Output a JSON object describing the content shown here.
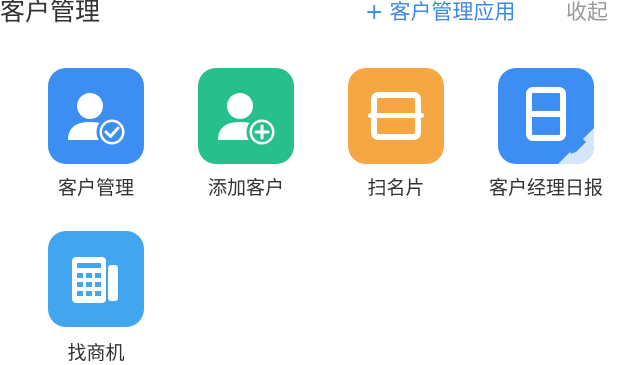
{
  "header": {
    "title": "客户管理",
    "action_plus": "+",
    "action_label": "客户管理应用",
    "collapse_label": "收起"
  },
  "apps": [
    {
      "label": "客户管理",
      "icon": "customer-check-icon",
      "color": "#3d8ef2"
    },
    {
      "label": "添加客户",
      "icon": "add-customer-icon",
      "color": "#27c08c"
    },
    {
      "label": "扫名片",
      "icon": "scan-card-icon",
      "color": "#f5a744"
    },
    {
      "label": "客户经理日报",
      "icon": "daily-report-icon",
      "color": "#3d8ef2"
    },
    {
      "label": "找商机",
      "icon": "find-opportunity-icon",
      "color": "#41a5ef"
    }
  ]
}
